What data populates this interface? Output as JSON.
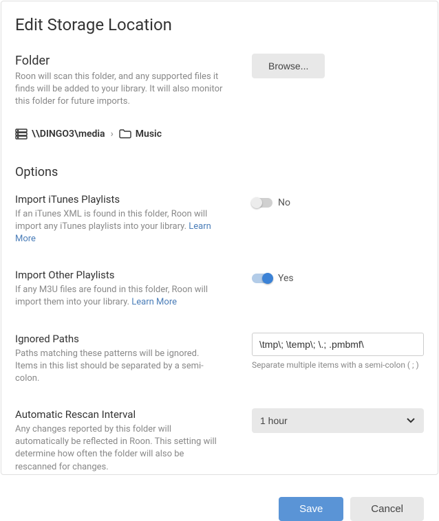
{
  "title": "Edit Storage Location",
  "folder": {
    "heading": "Folder",
    "description": "Roon will scan this folder, and any supported files it finds will be added to your library. It will also monitor this folder for future imports.",
    "browse_label": "Browse...",
    "network_path": "\\\\DINGO3\\media",
    "folder_name": "Music"
  },
  "options": {
    "heading": "Options",
    "import_itunes": {
      "title": "Import iTunes Playlists",
      "description": "If an iTunes XML is found in this folder, Roon will import any iTunes playlists into your library. ",
      "learn_more": "Learn More",
      "state_label": "No"
    },
    "import_other": {
      "title": "Import Other Playlists",
      "description": "If any M3U files are found in this folder, Roon will import them into your library. ",
      "learn_more": "Learn More",
      "state_label": "Yes"
    },
    "ignored_paths": {
      "title": "Ignored Paths",
      "description": "Paths matching these patterns will be ignored. Items in this list should be separated by a semi-colon.",
      "value": "\\tmp\\; \\temp\\; \\.; .pmbmf\\",
      "hint": "Separate multiple items with a semi-colon ( ; )"
    },
    "rescan": {
      "title": "Automatic Rescan Interval",
      "description": "Any changes reported by this folder will automatically be reflected in Roon. This setting will determine how often the folder will also be rescanned for changes.",
      "selected": "1 hour"
    }
  },
  "actions": {
    "save": "Save",
    "cancel": "Cancel"
  }
}
